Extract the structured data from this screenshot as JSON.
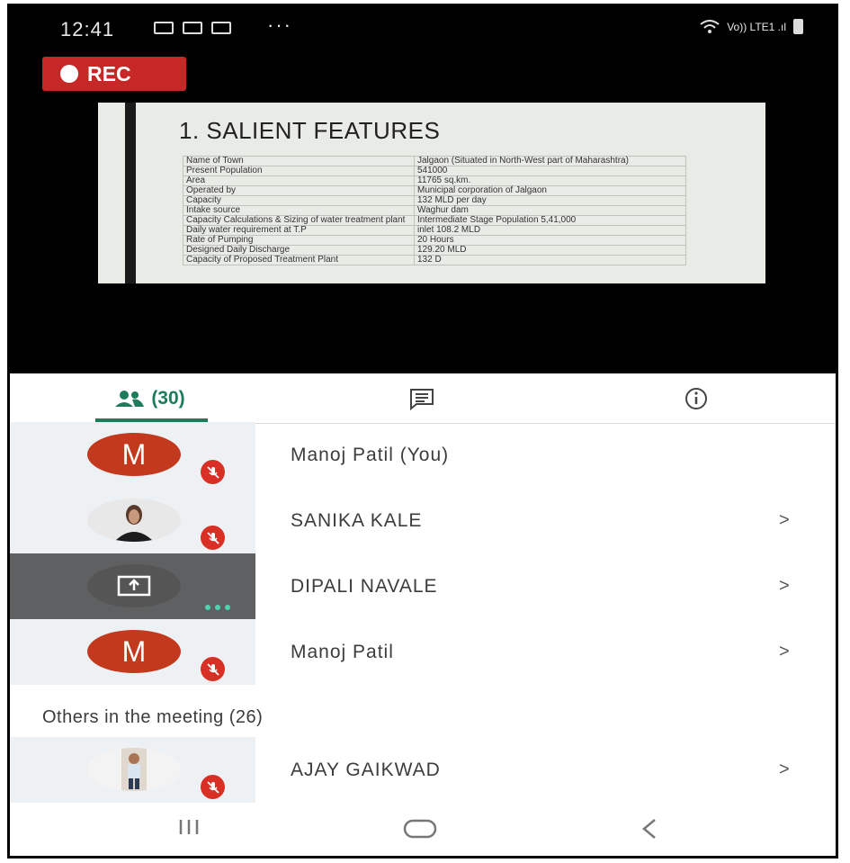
{
  "status_bar": {
    "time": "12:41",
    "more": "···",
    "network": "Vo)) LTE1 .ıl"
  },
  "recording": {
    "label": "REC"
  },
  "slide": {
    "title": "1. SALIENT FEATURES",
    "rows": [
      [
        "Name of Town",
        "Jalgaon (Situated in North-West part of Maharashtra)"
      ],
      [
        "Present Population",
        "541000"
      ],
      [
        "Area",
        "11765 sq.km."
      ],
      [
        "Operated by",
        "Municipal corporation of Jalgaon"
      ],
      [
        "Capacity",
        "132 MLD per day"
      ],
      [
        "Intake source",
        "Waghur dam"
      ],
      [
        "Capacity Calculations & Sizing of water treatment plant",
        "Intermediate Stage Population 5,41,000"
      ],
      [
        "Daily water requirement at T.P",
        "inlet 108.2 MLD"
      ],
      [
        "Rate of Pumping",
        "20 Hours"
      ],
      [
        "Designed Daily Discharge",
        "129.20 MLD"
      ],
      [
        "Capacity of Proposed Treatment Plant",
        "132 D"
      ]
    ]
  },
  "tabs": {
    "people_count": "(30)"
  },
  "participants": [
    {
      "name": "Manoj Patil (You)",
      "initial": "M"
    },
    {
      "name": "SANIKA KALE",
      "initial": ""
    },
    {
      "name": "DIPALI NAVALE",
      "initial": ""
    },
    {
      "name": "Manoj Patil",
      "initial": "M"
    }
  ],
  "others_heading": "Others in the meeting (26)",
  "others": [
    {
      "name": "AJAY GAIKWAD"
    }
  ],
  "chevron": ">",
  "colors": {
    "accent": "#1e7c5a",
    "avatar": "#c3391d",
    "mute": "#d93025",
    "rec": "#c62828"
  },
  "icons": [
    "people-icon",
    "chat-icon",
    "info-icon",
    "mic-off-icon",
    "present-screen-icon",
    "recent-apps-icon",
    "home-icon",
    "back-icon"
  ]
}
